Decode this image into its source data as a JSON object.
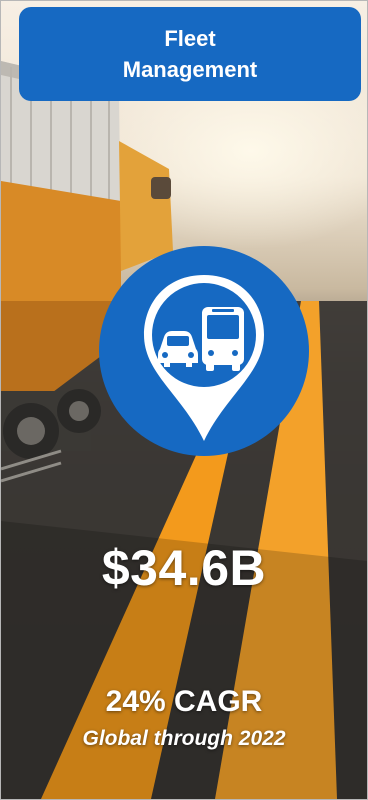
{
  "header": {
    "title": "Fleet Management"
  },
  "icon": {
    "name": "car-and-bus-location-pin-icon"
  },
  "metrics": {
    "market_size": "$34.6B",
    "growth": "24% CAGR",
    "scope": "Global through 2022"
  },
  "colors": {
    "brand_blue": "#1669c2",
    "road_orange": "#f39a1c",
    "text": "#ffffff"
  }
}
